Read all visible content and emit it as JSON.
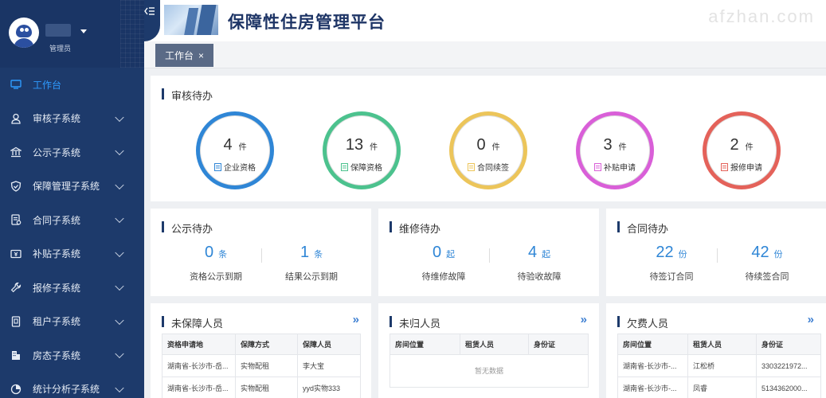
{
  "user": {
    "role": "管理员"
  },
  "header": {
    "title": "保障性住房管理平台",
    "watermark": "afzhan.com"
  },
  "sidebar": {
    "items": [
      {
        "label": "工作台",
        "icon": "monitor-icon",
        "active": true
      },
      {
        "label": "审核子系统",
        "icon": "user-icon"
      },
      {
        "label": "公示子系统",
        "icon": "bank-icon"
      },
      {
        "label": "保障管理子系统",
        "icon": "shield-icon"
      },
      {
        "label": "合同子系统",
        "icon": "contract-icon"
      },
      {
        "label": "补贴子系统",
        "icon": "subsidy-icon"
      },
      {
        "label": "报修子系统",
        "icon": "wrench-icon"
      },
      {
        "label": "租户子系统",
        "icon": "tenant-icon"
      },
      {
        "label": "房态子系统",
        "icon": "building-icon"
      },
      {
        "label": "统计分析子系统",
        "icon": "chart-icon"
      }
    ]
  },
  "tabs": [
    {
      "label": "工作台",
      "close": "×"
    }
  ],
  "review": {
    "title": "审核待办",
    "items": [
      {
        "value": "4",
        "unit": "件",
        "label": "企业资格",
        "color": "#2f86d6"
      },
      {
        "value": "13",
        "unit": "件",
        "label": "保障资格",
        "color": "#4cc28e"
      },
      {
        "value": "0",
        "unit": "件",
        "label": "合同续签",
        "color": "#ecc55a"
      },
      {
        "value": "3",
        "unit": "件",
        "label": "补贴申请",
        "color": "#d95fd8"
      },
      {
        "value": "2",
        "unit": "件",
        "label": "报修申请",
        "color": "#e4625a"
      }
    ]
  },
  "publicity": {
    "title": "公示待办",
    "items": [
      {
        "value": "0",
        "unit": "条",
        "label": "资格公示到期"
      },
      {
        "value": "1",
        "unit": "条",
        "label": "结果公示到期"
      }
    ]
  },
  "repair": {
    "title": "维修待办",
    "items": [
      {
        "value": "0",
        "unit": "起",
        "label": "待维修故障"
      },
      {
        "value": "4",
        "unit": "起",
        "label": "待验收故障"
      }
    ]
  },
  "contract": {
    "title": "合同待办",
    "items": [
      {
        "value": "22",
        "unit": "份",
        "label": "待签订合同"
      },
      {
        "value": "42",
        "unit": "份",
        "label": "待续签合同"
      }
    ]
  },
  "unprotected": {
    "title": "未保障人员",
    "more": "»",
    "headers": [
      "资格申请地",
      "保障方式",
      "保障人员"
    ],
    "rows": [
      [
        "湖南省-长沙市-岳...",
        "实物配租",
        "李大宝"
      ],
      [
        "湖南省-长沙市-岳...",
        "实物配租",
        "yyd实物333"
      ]
    ]
  },
  "unreturned": {
    "title": "未归人员",
    "more": "»",
    "headers": [
      "房间位置",
      "租赁人员",
      "身份证"
    ],
    "empty": "暂无数据"
  },
  "arrears": {
    "title": "欠费人员",
    "more": "»",
    "headers": [
      "房间位置",
      "租赁人员",
      "身份证"
    ],
    "rows": [
      [
        "湖南省-长沙市-...",
        "江松桥",
        "3303221972..."
      ],
      [
        "湖南省-长沙市-...",
        "凤睿",
        "5134362000..."
      ]
    ]
  }
}
